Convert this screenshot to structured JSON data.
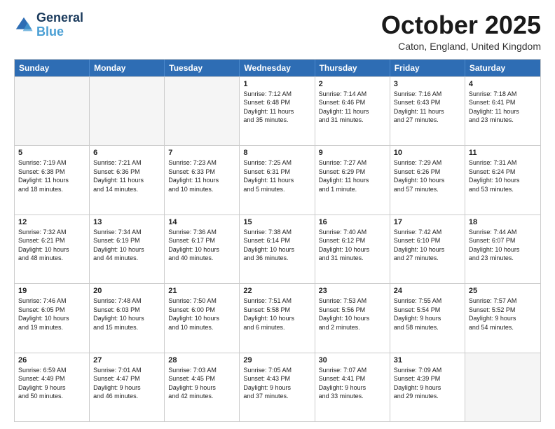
{
  "header": {
    "logo_line1": "General",
    "logo_line2": "Blue",
    "month": "October 2025",
    "location": "Caton, England, United Kingdom"
  },
  "days": [
    "Sunday",
    "Monday",
    "Tuesday",
    "Wednesday",
    "Thursday",
    "Friday",
    "Saturday"
  ],
  "rows": [
    [
      {
        "day": "",
        "empty": true,
        "text": ""
      },
      {
        "day": "",
        "empty": true,
        "text": ""
      },
      {
        "day": "",
        "empty": true,
        "text": ""
      },
      {
        "day": "1",
        "empty": false,
        "text": "Sunrise: 7:12 AM\nSunset: 6:48 PM\nDaylight: 11 hours\nand 35 minutes."
      },
      {
        "day": "2",
        "empty": false,
        "text": "Sunrise: 7:14 AM\nSunset: 6:46 PM\nDaylight: 11 hours\nand 31 minutes."
      },
      {
        "day": "3",
        "empty": false,
        "text": "Sunrise: 7:16 AM\nSunset: 6:43 PM\nDaylight: 11 hours\nand 27 minutes."
      },
      {
        "day": "4",
        "empty": false,
        "text": "Sunrise: 7:18 AM\nSunset: 6:41 PM\nDaylight: 11 hours\nand 23 minutes."
      }
    ],
    [
      {
        "day": "5",
        "empty": false,
        "text": "Sunrise: 7:19 AM\nSunset: 6:38 PM\nDaylight: 11 hours\nand 18 minutes."
      },
      {
        "day": "6",
        "empty": false,
        "text": "Sunrise: 7:21 AM\nSunset: 6:36 PM\nDaylight: 11 hours\nand 14 minutes."
      },
      {
        "day": "7",
        "empty": false,
        "text": "Sunrise: 7:23 AM\nSunset: 6:33 PM\nDaylight: 11 hours\nand 10 minutes."
      },
      {
        "day": "8",
        "empty": false,
        "text": "Sunrise: 7:25 AM\nSunset: 6:31 PM\nDaylight: 11 hours\nand 5 minutes."
      },
      {
        "day": "9",
        "empty": false,
        "text": "Sunrise: 7:27 AM\nSunset: 6:29 PM\nDaylight: 11 hours\nand 1 minute."
      },
      {
        "day": "10",
        "empty": false,
        "text": "Sunrise: 7:29 AM\nSunset: 6:26 PM\nDaylight: 10 hours\nand 57 minutes."
      },
      {
        "day": "11",
        "empty": false,
        "text": "Sunrise: 7:31 AM\nSunset: 6:24 PM\nDaylight: 10 hours\nand 53 minutes."
      }
    ],
    [
      {
        "day": "12",
        "empty": false,
        "text": "Sunrise: 7:32 AM\nSunset: 6:21 PM\nDaylight: 10 hours\nand 48 minutes."
      },
      {
        "day": "13",
        "empty": false,
        "text": "Sunrise: 7:34 AM\nSunset: 6:19 PM\nDaylight: 10 hours\nand 44 minutes."
      },
      {
        "day": "14",
        "empty": false,
        "text": "Sunrise: 7:36 AM\nSunset: 6:17 PM\nDaylight: 10 hours\nand 40 minutes."
      },
      {
        "day": "15",
        "empty": false,
        "text": "Sunrise: 7:38 AM\nSunset: 6:14 PM\nDaylight: 10 hours\nand 36 minutes."
      },
      {
        "day": "16",
        "empty": false,
        "text": "Sunrise: 7:40 AM\nSunset: 6:12 PM\nDaylight: 10 hours\nand 31 minutes."
      },
      {
        "day": "17",
        "empty": false,
        "text": "Sunrise: 7:42 AM\nSunset: 6:10 PM\nDaylight: 10 hours\nand 27 minutes."
      },
      {
        "day": "18",
        "empty": false,
        "text": "Sunrise: 7:44 AM\nSunset: 6:07 PM\nDaylight: 10 hours\nand 23 minutes."
      }
    ],
    [
      {
        "day": "19",
        "empty": false,
        "text": "Sunrise: 7:46 AM\nSunset: 6:05 PM\nDaylight: 10 hours\nand 19 minutes."
      },
      {
        "day": "20",
        "empty": false,
        "text": "Sunrise: 7:48 AM\nSunset: 6:03 PM\nDaylight: 10 hours\nand 15 minutes."
      },
      {
        "day": "21",
        "empty": false,
        "text": "Sunrise: 7:50 AM\nSunset: 6:00 PM\nDaylight: 10 hours\nand 10 minutes."
      },
      {
        "day": "22",
        "empty": false,
        "text": "Sunrise: 7:51 AM\nSunset: 5:58 PM\nDaylight: 10 hours\nand 6 minutes."
      },
      {
        "day": "23",
        "empty": false,
        "text": "Sunrise: 7:53 AM\nSunset: 5:56 PM\nDaylight: 10 hours\nand 2 minutes."
      },
      {
        "day": "24",
        "empty": false,
        "text": "Sunrise: 7:55 AM\nSunset: 5:54 PM\nDaylight: 9 hours\nand 58 minutes."
      },
      {
        "day": "25",
        "empty": false,
        "text": "Sunrise: 7:57 AM\nSunset: 5:52 PM\nDaylight: 9 hours\nand 54 minutes."
      }
    ],
    [
      {
        "day": "26",
        "empty": false,
        "text": "Sunrise: 6:59 AM\nSunset: 4:49 PM\nDaylight: 9 hours\nand 50 minutes."
      },
      {
        "day": "27",
        "empty": false,
        "text": "Sunrise: 7:01 AM\nSunset: 4:47 PM\nDaylight: 9 hours\nand 46 minutes."
      },
      {
        "day": "28",
        "empty": false,
        "text": "Sunrise: 7:03 AM\nSunset: 4:45 PM\nDaylight: 9 hours\nand 42 minutes."
      },
      {
        "day": "29",
        "empty": false,
        "text": "Sunrise: 7:05 AM\nSunset: 4:43 PM\nDaylight: 9 hours\nand 37 minutes."
      },
      {
        "day": "30",
        "empty": false,
        "text": "Sunrise: 7:07 AM\nSunset: 4:41 PM\nDaylight: 9 hours\nand 33 minutes."
      },
      {
        "day": "31",
        "empty": false,
        "text": "Sunrise: 7:09 AM\nSunset: 4:39 PM\nDaylight: 9 hours\nand 29 minutes."
      },
      {
        "day": "",
        "empty": true,
        "text": ""
      }
    ]
  ]
}
